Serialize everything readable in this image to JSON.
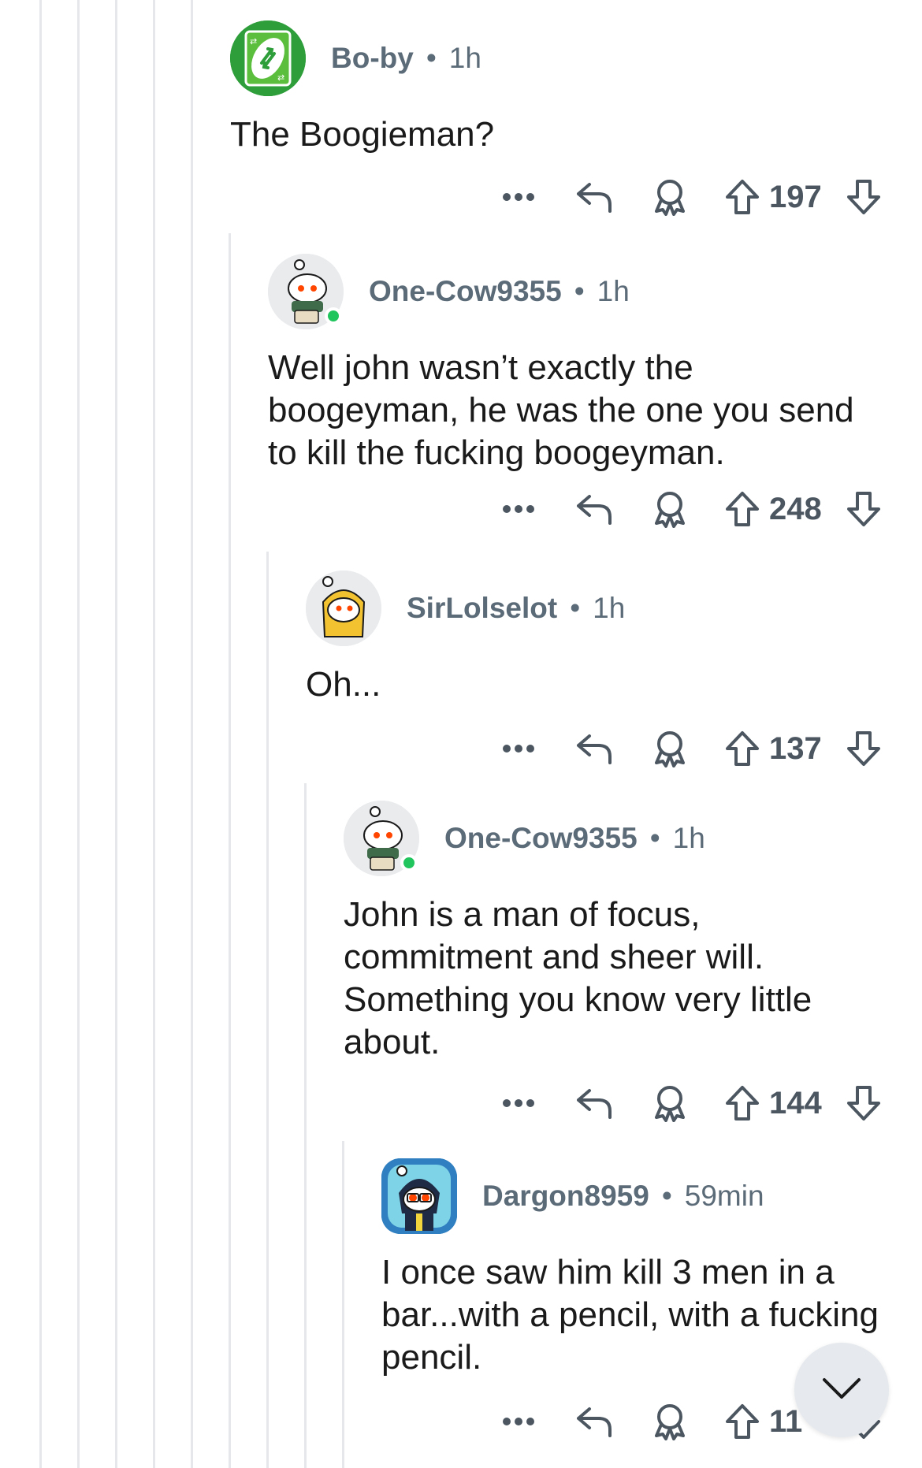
{
  "comments": [
    {
      "author": "Bo-by",
      "sep": "•",
      "time": "1h",
      "text": "The Boogieman?",
      "score": "197",
      "avatar": "uno-reverse-card-icon",
      "online": false
    },
    {
      "author": "One-Cow9355",
      "sep": "•",
      "time": "1h",
      "text": "Well john wasn’t exactly the boogeyman, he was the one you send to kill the fucking boogeyman.",
      "score": "248",
      "avatar": "snoo-avatar-icon",
      "online": true
    },
    {
      "author": "SirLolselot",
      "sep": "•",
      "time": "1h",
      "text": "Oh...",
      "score": "137",
      "avatar": "snoo-avatar-icon",
      "online": false
    },
    {
      "author": "One-Cow9355",
      "sep": "•",
      "time": "1h",
      "text": "John is a man of focus, commitment and sheer will. Something you know very little about.",
      "score": "144",
      "avatar": "snoo-avatar-icon",
      "online": true
    },
    {
      "author": "Dargon8959",
      "sep": "•",
      "time": "59min",
      "text": "I once saw him kill 3 men in a bar...with a pencil, with a fucking pencil.",
      "score": "11",
      "avatar": "snoo-avatar-icon",
      "online": false
    }
  ],
  "icons": {
    "more": "more-options-icon",
    "reply": "reply-icon",
    "award": "award-icon",
    "upvote": "upvote-arrow-icon",
    "downvote": "downvote-arrow-icon",
    "scroll": "chevron-down-icon"
  },
  "colors": {
    "online": "#21c55d",
    "uno_green": "#2e9e3b",
    "thread_line": "#e5e7ea",
    "meta_text": "#5c6b78"
  }
}
